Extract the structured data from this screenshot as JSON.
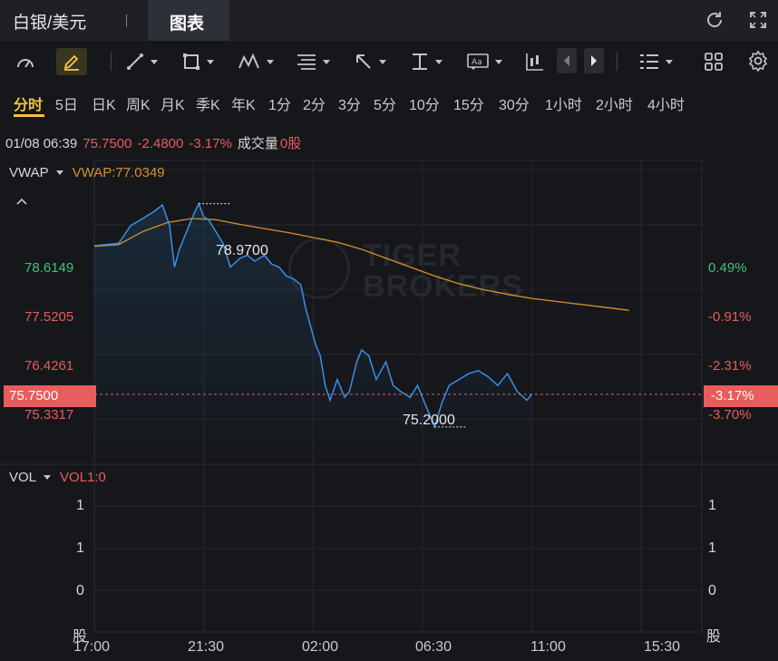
{
  "header": {
    "title": "白银/美元",
    "active_tab": "图表"
  },
  "timeframes": [
    "分时",
    "5日",
    "日K",
    "周K",
    "月K",
    "季K",
    "年K",
    "1分",
    "2分",
    "3分",
    "5分",
    "10分",
    "15分",
    "30分",
    "1小时",
    "2小时",
    "4小时"
  ],
  "active_timeframe": "分时",
  "info": {
    "datetime": "01/08 06:39",
    "price": "75.7500",
    "change": "-2.4800",
    "change_pct": "-3.17%",
    "volume_label": "成交量",
    "volume_value": "0股"
  },
  "vwap": {
    "label": "VWAP",
    "value_text": "VWAP:77.0349",
    "collapse_icon": "chevron-up-icon"
  },
  "vol": {
    "label": "VOL",
    "value_text": "VOL1:0",
    "left_ticks": [
      "1",
      "1",
      "0",
      "股"
    ],
    "right_ticks": [
      "1",
      "1",
      "0",
      "股"
    ]
  },
  "price_axis": {
    "left": [
      {
        "text": "78.6149",
        "value": 78.6149,
        "color": "#3ec27d"
      },
      {
        "text": "77.5205",
        "value": 77.5205,
        "color": "#e85c5c"
      },
      {
        "text": "76.4261",
        "value": 76.4261,
        "color": "#e85c5c"
      },
      {
        "text": "75.3317",
        "value": 75.3317,
        "color": "#e85c5c"
      }
    ],
    "right": [
      {
        "text": "0.49%",
        "value": 78.6149,
        "color": "#3ec27d"
      },
      {
        "text": "-0.91%",
        "value": 77.5205,
        "color": "#e85c5c"
      },
      {
        "text": "-2.31%",
        "value": 76.4261,
        "color": "#e85c5c"
      },
      {
        "text": "-3.70%",
        "value": 75.3317,
        "color": "#e85c5c"
      }
    ],
    "current_left": "75.7500",
    "current_right": "-3.17%"
  },
  "annotations": {
    "high": "78.9700",
    "low": "75.2000"
  },
  "x_ticks": [
    "17:00",
    "21:30",
    "02:00",
    "06:30",
    "11:00",
    "15:30"
  ],
  "colors": {
    "accent": "#f5c342",
    "up": "#3ec27d",
    "down": "#e85c5c",
    "price_line": "#3b8ee8",
    "vwap_line": "#d4912c"
  },
  "chart_data": {
    "type": "line",
    "y_range": [
      74.6,
      79.7
    ],
    "current_price": 75.75,
    "series": [
      {
        "name": "VWAP",
        "points": [
          [
            0,
            78.25
          ],
          [
            1,
            78.28
          ],
          [
            2,
            78.5
          ],
          [
            3,
            78.65
          ],
          [
            4,
            78.72
          ],
          [
            5,
            78.7
          ],
          [
            6,
            78.62
          ],
          [
            7,
            78.55
          ],
          [
            8,
            78.48
          ],
          [
            9,
            78.4
          ],
          [
            10,
            78.32
          ],
          [
            11,
            78.2
          ],
          [
            12,
            78.05
          ],
          [
            13,
            77.9
          ],
          [
            14,
            77.75
          ],
          [
            15,
            77.62
          ],
          [
            16,
            77.52
          ],
          [
            17,
            77.44
          ],
          [
            18,
            77.37
          ],
          [
            19,
            77.32
          ],
          [
            20,
            77.27
          ],
          [
            21,
            77.22
          ],
          [
            22,
            77.17
          ]
        ]
      },
      {
        "name": "",
        "points": [
          [
            0,
            78.26
          ],
          [
            1,
            78.3
          ],
          [
            1.5,
            78.6
          ],
          [
            2,
            78.72
          ],
          [
            2.5,
            78.85
          ],
          [
            2.8,
            78.95
          ],
          [
            3.1,
            78.6
          ],
          [
            3.3,
            77.9
          ],
          [
            3.5,
            78.2
          ],
          [
            3.7,
            78.4
          ],
          [
            3.9,
            78.6
          ],
          [
            4.1,
            78.8
          ],
          [
            4.3,
            78.97
          ],
          [
            4.5,
            78.75
          ],
          [
            4.7,
            78.7
          ],
          [
            5,
            78.5
          ],
          [
            5.3,
            78.3
          ],
          [
            5.6,
            77.9
          ],
          [
            6,
            78.05
          ],
          [
            6.3,
            78.1
          ],
          [
            6.6,
            78.0
          ],
          [
            7,
            78.1
          ],
          [
            7.3,
            77.95
          ],
          [
            7.6,
            77.9
          ],
          [
            7.9,
            77.75
          ],
          [
            8.2,
            77.7
          ],
          [
            8.5,
            77.6
          ],
          [
            8.7,
            77.2
          ],
          [
            8.9,
            76.9
          ],
          [
            9.1,
            76.6
          ],
          [
            9.3,
            76.4
          ],
          [
            9.5,
            75.9
          ],
          [
            9.7,
            75.65
          ],
          [
            10,
            76.0
          ],
          [
            10.3,
            75.7
          ],
          [
            10.5,
            75.8
          ],
          [
            10.8,
            76.3
          ],
          [
            11,
            76.5
          ],
          [
            11.3,
            76.4
          ],
          [
            11.6,
            76.0
          ],
          [
            12,
            76.3
          ],
          [
            12.3,
            75.9
          ],
          [
            12.6,
            75.8
          ],
          [
            13,
            75.7
          ],
          [
            13.3,
            75.9
          ],
          [
            13.6,
            75.6
          ],
          [
            14,
            75.2
          ],
          [
            14.3,
            75.6
          ],
          [
            14.6,
            75.9
          ],
          [
            15,
            76.0
          ],
          [
            15.4,
            76.1
          ],
          [
            15.8,
            76.15
          ],
          [
            16.2,
            76.05
          ],
          [
            16.6,
            75.9
          ],
          [
            17,
            76.1
          ],
          [
            17.4,
            75.8
          ],
          [
            17.8,
            75.65
          ],
          [
            18,
            75.75
          ]
        ]
      }
    ],
    "x_range_hours": [
      0,
      25
    ],
    "annotations": [
      {
        "label": "78.9700",
        "value": 78.97
      },
      {
        "label": "75.2000",
        "value": 75.2
      }
    ]
  }
}
